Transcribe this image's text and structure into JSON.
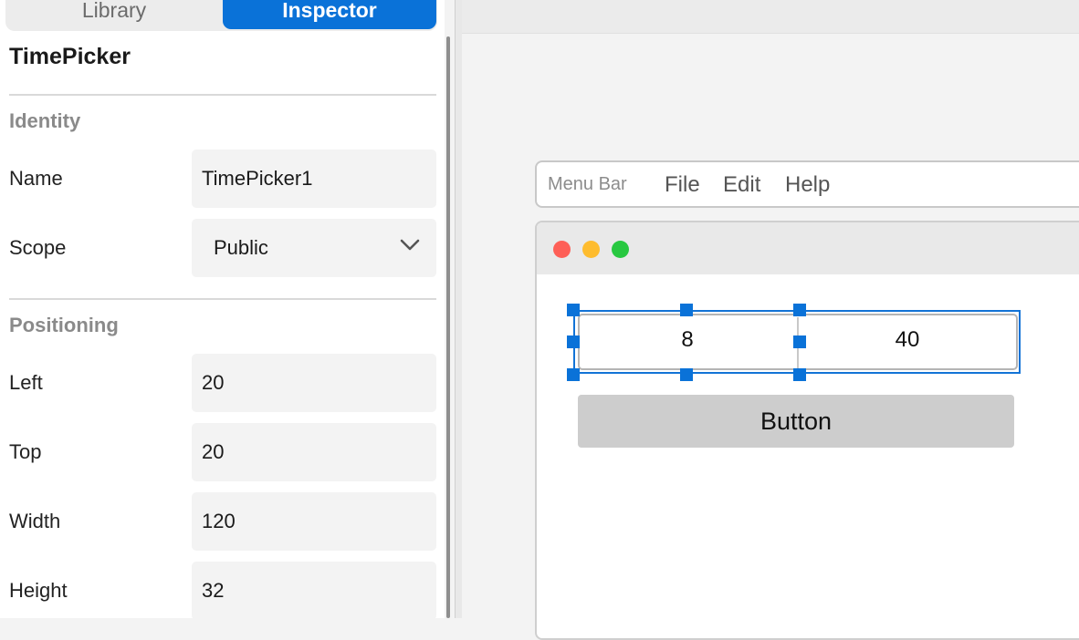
{
  "tabs": {
    "library": "Library",
    "inspector": "Inspector"
  },
  "inspector": {
    "object_title": "TimePicker",
    "identity": {
      "section": "Identity",
      "name_label": "Name",
      "name_value": "TimePicker1",
      "scope_label": "Scope",
      "scope_value": "Public"
    },
    "positioning": {
      "section": "Positioning",
      "left_label": "Left",
      "left_value": "20",
      "top_label": "Top",
      "top_value": "20",
      "width_label": "Width",
      "width_value": "120",
      "height_label": "Height",
      "height_value": "32"
    }
  },
  "canvas": {
    "menubar": {
      "caption": "Menu Bar",
      "items": [
        "File",
        "Edit",
        "Help"
      ]
    },
    "window": {
      "traffic_lights": [
        "#fe5f57",
        "#febc2e",
        "#28c840"
      ],
      "timepicker": {
        "hour": "8",
        "minute": "40"
      },
      "button_label": "Button"
    }
  },
  "colors": {
    "accent": "#0a72d8"
  }
}
